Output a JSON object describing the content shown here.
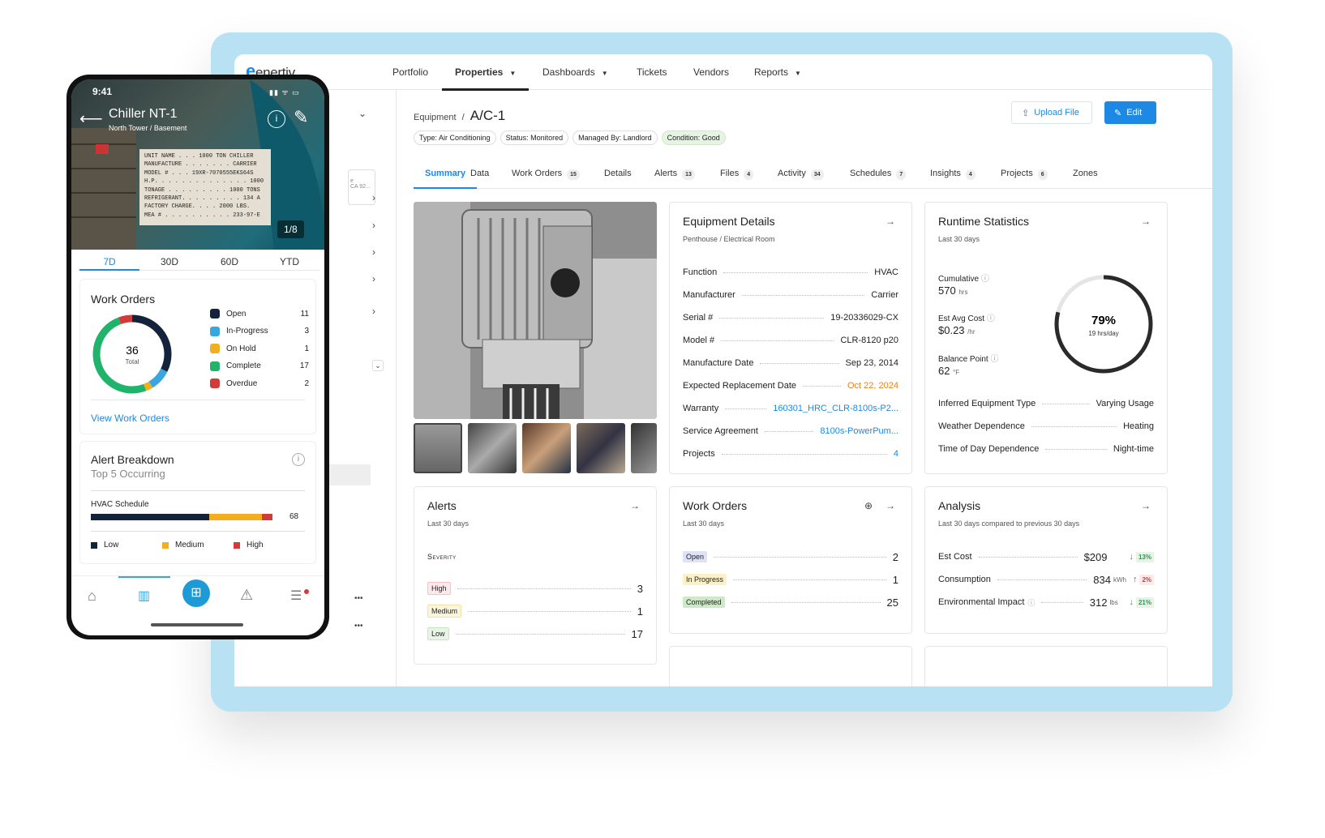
{
  "app": {
    "logo": "enertiv"
  },
  "topnav": [
    {
      "label": "Portfolio"
    },
    {
      "label": "Properties",
      "active": true,
      "caret": true
    },
    {
      "label": "Dashboards",
      "caret": true
    },
    {
      "label": "Tickets"
    },
    {
      "label": "Vendors"
    },
    {
      "label": "Reports",
      "caret": true
    }
  ],
  "sidebar": {
    "select_hint": "e\nCA 92..."
  },
  "breadcrumb": {
    "parent": "Equipment",
    "sep": "/",
    "title": "A/C-1"
  },
  "tags": [
    {
      "label": "Type: Air Conditioning"
    },
    {
      "label": "Status: Monitored"
    },
    {
      "label": "Managed By: Landlord"
    },
    {
      "label": "Condition: Good",
      "good": true
    }
  ],
  "actions": {
    "upload": "Upload File",
    "edit": "Edit"
  },
  "tabs": [
    {
      "label": "Summary",
      "active": true
    },
    {
      "label": "Data"
    },
    {
      "label": "Work Orders",
      "count": "15"
    },
    {
      "label": "Details"
    },
    {
      "label": "Alerts",
      "count": "13"
    },
    {
      "label": "Files",
      "count": "4"
    },
    {
      "label": "Activity",
      "count": "34"
    },
    {
      "label": "Schedules",
      "count": "7"
    },
    {
      "label": "Insights",
      "count": "4"
    },
    {
      "label": "Projects",
      "count": "6"
    },
    {
      "label": "Zones"
    }
  ],
  "equipment_details": {
    "title": "Equipment Details",
    "subtitle": "Penthouse / Electrical Room",
    "rows": [
      {
        "k": "Function",
        "v": "HVAC"
      },
      {
        "k": "Manufacturer",
        "v": "Carrier"
      },
      {
        "k": "Serial #",
        "v": "19-20336029-CX"
      },
      {
        "k": "Model #",
        "v": "CLR-8120 p20"
      },
      {
        "k": "Manufacture Date",
        "v": "Sep 23, 2014"
      },
      {
        "k": "Expected Replacement Date",
        "v": "Oct 22, 2024",
        "c": "orange"
      },
      {
        "k": "Warranty",
        "v": "160301_HRC_CLR-8100s-P2...",
        "c": "blue"
      },
      {
        "k": "Service Agreement",
        "v": "8100s-PowerPum...",
        "c": "blue"
      },
      {
        "k": "Projects",
        "v": "4",
        "c": "blue"
      }
    ]
  },
  "runtime": {
    "title": "Runtime Statistics",
    "subtitle": "Last 30 days",
    "cumulative_label": "Cumulative",
    "cumulative_value": "570",
    "cumulative_unit": "hrs",
    "cost_label": "Est Avg Cost",
    "cost_value": "$0.23",
    "cost_unit": "/hr",
    "balance_label": "Balance Point",
    "balance_value": "62",
    "balance_unit": "°F",
    "gauge_pct": "79%",
    "gauge_fraction": 0.79,
    "gauge_sub": "19 hrs/day",
    "rows": [
      {
        "k": "Inferred Equipment Type",
        "v": "Varying Usage"
      },
      {
        "k": "Weather Dependence",
        "v": "Heating"
      },
      {
        "k": "Time of Day Dependence",
        "v": "Night-time"
      }
    ]
  },
  "alerts": {
    "title": "Alerts",
    "subtitle": "Last 30 days",
    "severity": "Severity",
    "rows": [
      {
        "k": "High",
        "v": "3",
        "bg": "#fde8ea",
        "bc": "#f6c1c6"
      },
      {
        "k": "Medium",
        "v": "1",
        "bg": "#fdf5da",
        "bc": "#f1e2a4"
      },
      {
        "k": "Low",
        "v": "17",
        "bg": "#e8f5e6",
        "bc": "#c6e6c0"
      }
    ]
  },
  "work_orders": {
    "title": "Work Orders",
    "subtitle": "Last 30 days",
    "rows": [
      {
        "k": "Open",
        "v": "2",
        "bg": "#dfe2f6"
      },
      {
        "k": "In Progress",
        "v": "1",
        "bg": "#fbf1c9"
      },
      {
        "k": "Completed",
        "v": "25",
        "bg": "#cde9c8"
      }
    ]
  },
  "analysis": {
    "title": "Analysis",
    "subtitle": "Last 30 days compared to previous 30 days",
    "rows": [
      {
        "k": "Est Cost",
        "v": "$209",
        "u": "",
        "d": "13%",
        "dir": "down"
      },
      {
        "k": "Consumption",
        "v": "834",
        "u": "kWh",
        "d": "2%",
        "dir": "up"
      },
      {
        "k": "Environmental Impact",
        "v": "312",
        "u": "lbs",
        "d": "21%",
        "dir": "down",
        "info": true
      }
    ]
  },
  "phone": {
    "time": "9:41",
    "title": "Chiller NT-1",
    "subtitle": "North Tower / Basement",
    "counter": "1/8",
    "plate": "UNIT NAME . . . 1000 TON CHILLER\nMANUFACTURE . . . . . . . CARRIER\nMODEL # . . . 19XR-7070555EKS64S\nH.P. . . . . . . . . . . . . . 1000\nTONAGE . . . . . . . . . 1000 TONS\nREFRIGERANT. . . . . . . . . 134 A\nFACTORY CHARGE. . . . 2000 LBS.\nMEA # . . . . . . . . . . 233-97-E",
    "segments": [
      {
        "label": "7D",
        "active": true
      },
      {
        "label": "30D"
      },
      {
        "label": "60D"
      },
      {
        "label": "YTD"
      }
    ],
    "wo_title": "Work Orders",
    "wo_total": "36",
    "wo_total_label": "Total",
    "wo_legend": [
      {
        "k": "Open",
        "v": "11",
        "c": "#14233c"
      },
      {
        "k": "In-Progress",
        "v": "3",
        "c": "#3aa6e0"
      },
      {
        "k": "On Hold",
        "v": "1",
        "c": "#f2ae1c"
      },
      {
        "k": "Complete",
        "v": "17",
        "c": "#1fb36b"
      },
      {
        "k": "Overdue",
        "v": "2",
        "c": "#d33a3a"
      }
    ],
    "view_link": "View Work Orders",
    "alert_title": "Alert Breakdown",
    "alert_sub": "Top 5 Occurring",
    "schedule_label": "HVAC Schedule",
    "schedule_value": "68",
    "schedule_split": [
      {
        "c": "#14233c",
        "f": 0.65
      },
      {
        "c": "#f2ae1c",
        "f": 0.29
      },
      {
        "c": "#d33a3a",
        "f": 0.06
      }
    ],
    "alert_legend": [
      {
        "k": "Low",
        "c": "#14233c"
      },
      {
        "k": "Medium",
        "c": "#f2ae1c"
      },
      {
        "k": "High",
        "c": "#d33a3a"
      }
    ]
  }
}
